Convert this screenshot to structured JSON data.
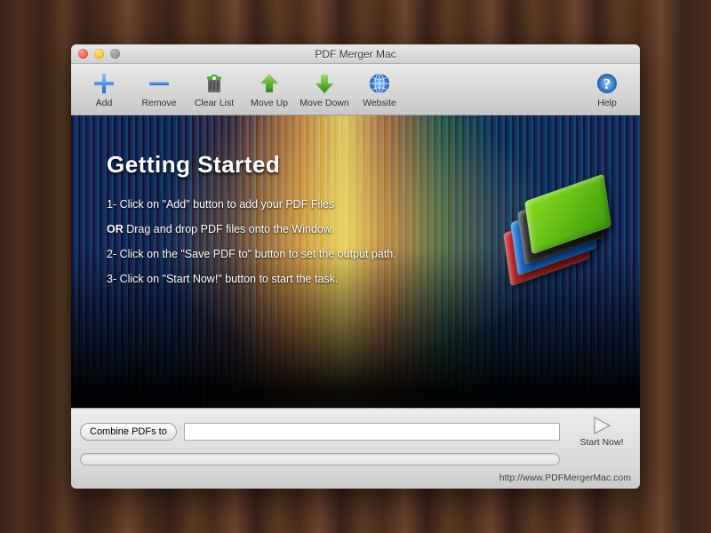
{
  "window": {
    "title": "PDF Merger Mac"
  },
  "toolbar": {
    "add": "Add",
    "remove": "Remove",
    "clearlist": "Clear List",
    "moveup": "Move Up",
    "movedown": "Move Down",
    "website": "Website",
    "help": "Help"
  },
  "content": {
    "heading": "Getting Started",
    "line1": "1- Click on \"Add\" button to add your PDF Files",
    "or_prefix": "OR",
    "line_or_rest": " Drag and drop PDF files onto the Window.",
    "line2": "2- Click on the \"Save PDF to\" button to set the output path.",
    "line3": "3- Click on \"Start Now!\" button to start the task."
  },
  "bottom": {
    "combine_label": "Combine PDFs to",
    "path_value": "",
    "start_label": "Start Now!"
  },
  "footer": {
    "url": "http://www.PDFMergerMac.com"
  },
  "icons": {
    "add": "plus-icon",
    "remove": "minus-icon",
    "clearlist": "trash-icon",
    "moveup": "arrow-up-icon",
    "movedown": "arrow-down-icon",
    "website": "globe-icon",
    "help": "help-icon",
    "start": "play-icon"
  },
  "colors": {
    "accent_blue": "#3b8de0",
    "accent_green": "#4caf30",
    "accent_orange": "#ff9a1a"
  }
}
